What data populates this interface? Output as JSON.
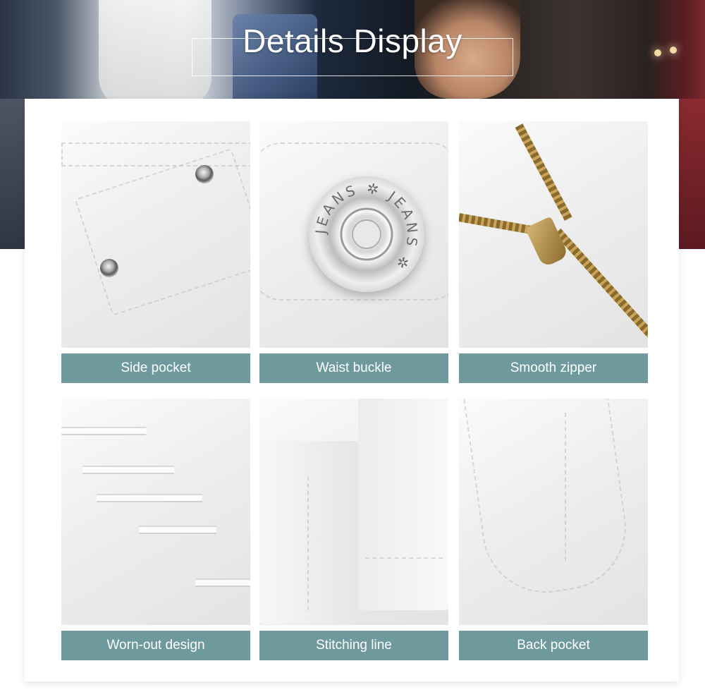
{
  "header": {
    "title": "Details Display"
  },
  "details": [
    {
      "caption": "Side pocket",
      "icon": "side-pocket-photo"
    },
    {
      "caption": "Waist buckle",
      "icon": "waist-buckle-photo"
    },
    {
      "caption": "Smooth zipper",
      "icon": "smooth-zipper-photo"
    },
    {
      "caption": "Worn-out design",
      "icon": "worn-out-photo"
    },
    {
      "caption": "Stitching line",
      "icon": "stitching-line-photo"
    },
    {
      "caption": "Back pocket",
      "icon": "back-pocket-photo"
    }
  ],
  "button_text": "JEANS",
  "colors": {
    "caption_bg": "#6e9a9e",
    "card_bg": "#ffffff",
    "title_text": "#ffffff"
  }
}
